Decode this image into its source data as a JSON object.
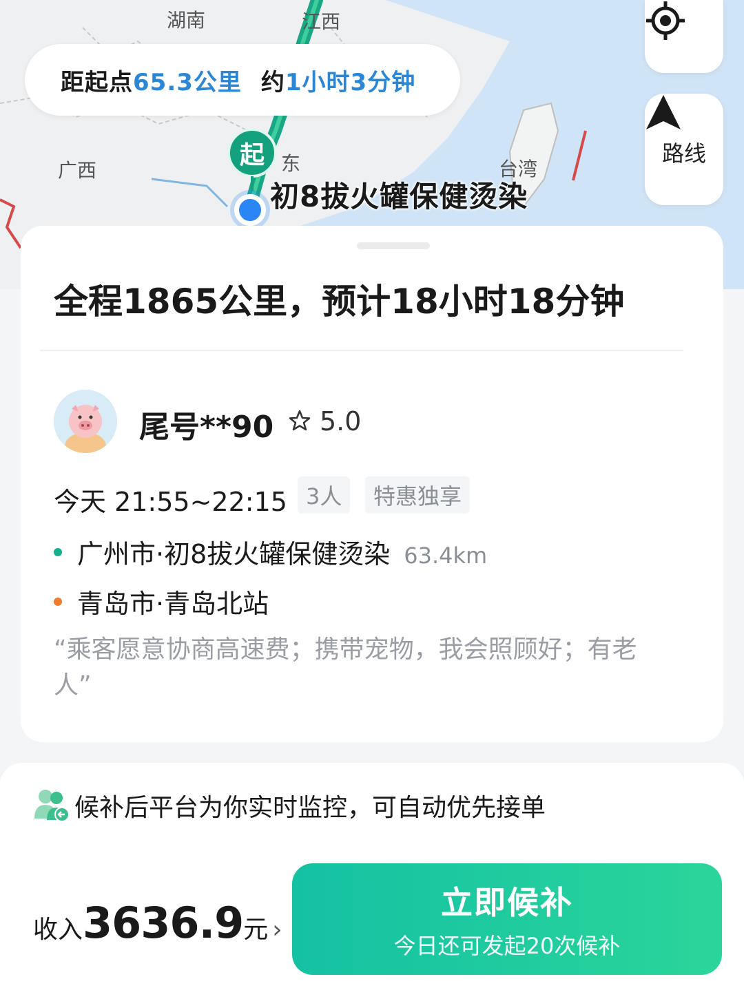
{
  "map": {
    "region_labels": [
      "湖南",
      "江西",
      "广西",
      "东",
      "台湾"
    ],
    "distance_pill": {
      "prefix": "距起点",
      "distance": "65.3公里",
      "approx_prefix": "约",
      "duration": "1小时3分钟"
    },
    "locate_icon": "crosshair-icon",
    "route_button": {
      "icon": "navigation-arrow-icon",
      "label": "路线"
    },
    "start_pin_label": "起",
    "pickup_label": "初8拔火罐保健烫染"
  },
  "trip": {
    "summary": "全程1865公里，预计18小时18分钟",
    "driver": {
      "name": "尾号**90",
      "rating": "5.0"
    },
    "time": "今天 21:55~22:15",
    "tags": [
      "3人",
      "特惠独享"
    ],
    "from": {
      "name": "广州市·初8拔火罐保健烫染",
      "distance": "63.4km"
    },
    "to": {
      "name": "青岛市·青岛北站"
    },
    "remark": "“乘客愿意协商高速费；携带宠物，我会照顾好；有老人”"
  },
  "bottom": {
    "notice": "候补后平台为你实时监控，可自动优先接单",
    "income_prefix": "收入",
    "income_amount": "3636.9",
    "income_unit": "元",
    "income_chevron": "›",
    "cta_label": "立即候补",
    "cta_sub": "今日还可发起20次候补"
  },
  "colors": {
    "accent_green": "#13a07d",
    "accent_blue": "#2b86d6",
    "origin_dot": "#13b08c",
    "destination_dot": "#f07b2f",
    "cta_gradient_start": "#14c1a3",
    "cta_gradient_end": "#2bd59a"
  }
}
